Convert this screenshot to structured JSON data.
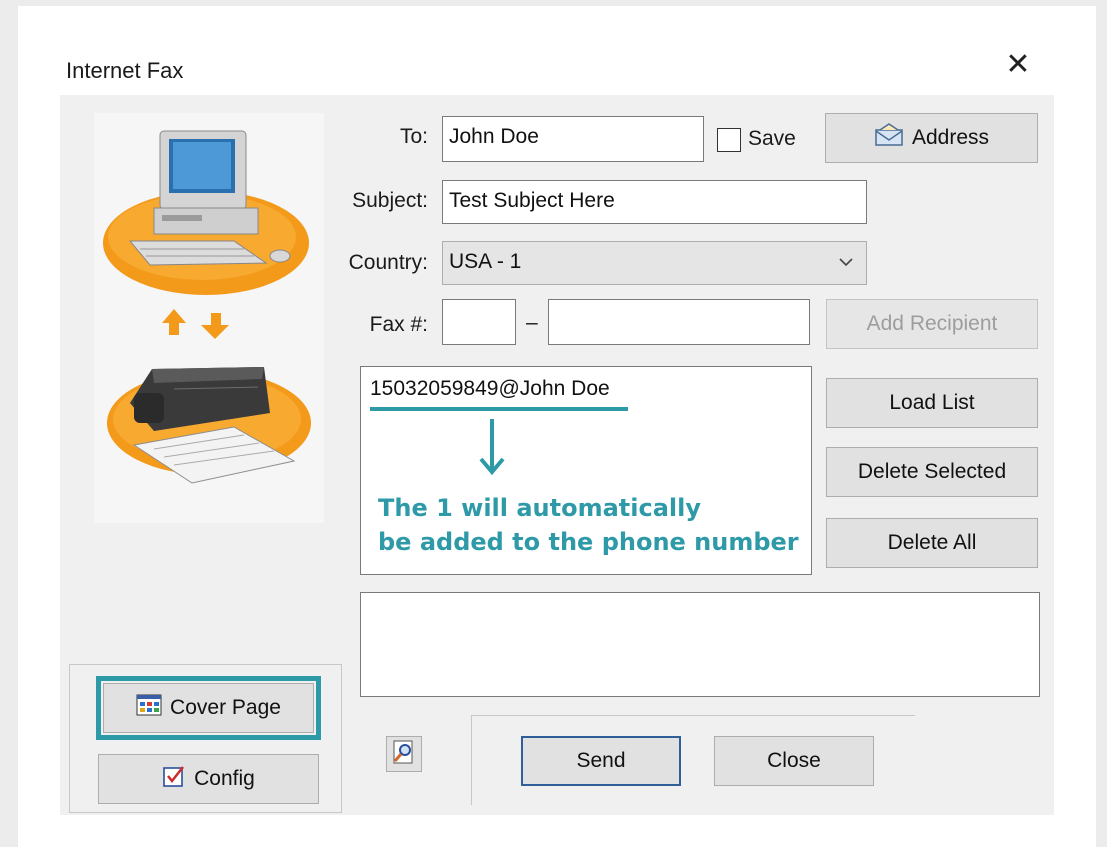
{
  "window": {
    "title": "Internet Fax"
  },
  "form": {
    "to_label": "To:",
    "to_value": "John Doe",
    "save_label": "Save",
    "address_label": "Address",
    "subject_label": "Subject:",
    "subject_value": "Test Subject Here",
    "country_label": "Country:",
    "country_value": "USA - 1",
    "fax_label": "Fax #:",
    "fax_separator": "–",
    "add_recipient_label": "Add Recipient"
  },
  "recipients": {
    "items": [
      "15032059849@John Doe"
    ]
  },
  "annotation": {
    "line1": "The 1 will automatically",
    "line2": "be added to the phone number",
    "color": "#2e9aa8"
  },
  "list_buttons": {
    "load_list": "Load List",
    "delete_selected": "Delete Selected",
    "delete_all": "Delete All"
  },
  "bottom": {
    "cover_page": "Cover Page",
    "config": "Config",
    "send": "Send",
    "close": "Close"
  },
  "icons": {
    "close": "close-icon",
    "address": "envelope-icon",
    "dropdown": "chevron-down-icon",
    "cover_page": "grid-icon",
    "config": "checkbox-icon",
    "preview": "magnifier-icon"
  },
  "colors": {
    "highlight": "#2e9aa8",
    "send_border": "#2f5e99",
    "illustration_orange": "#f39a1b"
  }
}
